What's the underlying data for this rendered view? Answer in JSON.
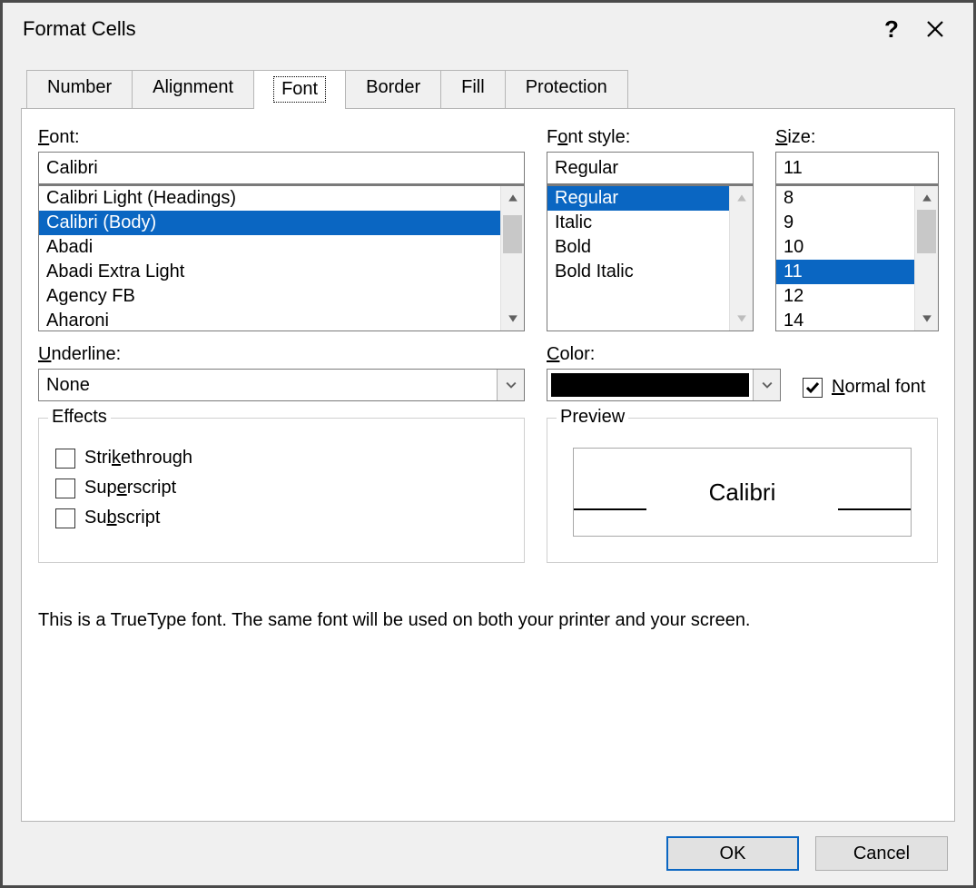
{
  "title": "Format Cells",
  "tabs": [
    "Number",
    "Alignment",
    "Font",
    "Border",
    "Fill",
    "Protection"
  ],
  "active_tab_index": 2,
  "font": {
    "label": "Font:",
    "value": "Calibri",
    "items": [
      "Calibri Light (Headings)",
      "Calibri (Body)",
      "Abadi",
      "Abadi Extra Light",
      "Agency FB",
      "Aharoni"
    ],
    "selected_index": 1
  },
  "style": {
    "label": "Font style:",
    "value": "Regular",
    "items": [
      "Regular",
      "Italic",
      "Bold",
      "Bold Italic"
    ],
    "selected_index": 0
  },
  "size": {
    "label": "Size:",
    "value": "11",
    "items": [
      "8",
      "9",
      "10",
      "11",
      "12",
      "14"
    ],
    "selected_index": 3
  },
  "underline": {
    "label": "Underline:",
    "value": "None"
  },
  "color": {
    "label": "Color:",
    "swatch": "#000000"
  },
  "normal_font": {
    "label": "Normal font",
    "checked": true
  },
  "effects": {
    "legend": "Effects",
    "strikethrough": {
      "label": "Strikethrough",
      "checked": false
    },
    "superscript": {
      "label": "Superscript",
      "checked": false
    },
    "subscript": {
      "label": "Subscript",
      "checked": false
    }
  },
  "preview": {
    "legend": "Preview",
    "text": "Calibri"
  },
  "info_text": "This is a TrueType font.  The same font will be used on both your printer and your screen.",
  "buttons": {
    "ok": "OK",
    "cancel": "Cancel"
  }
}
